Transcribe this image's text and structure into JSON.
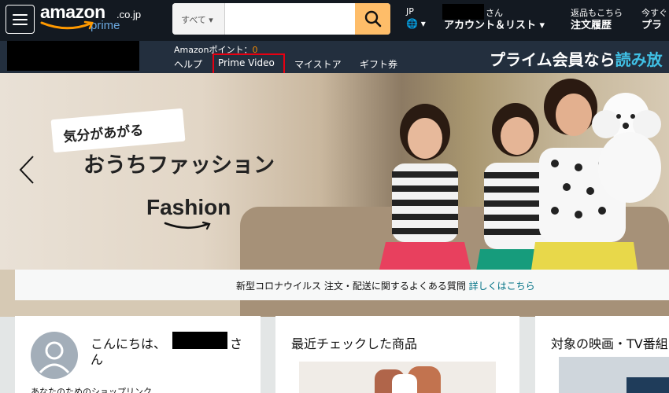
{
  "header": {
    "logo": {
      "word": "amazon",
      "tld": ".co.jp",
      "sub": "prime"
    },
    "search": {
      "category": "すべて ▾",
      "placeholder": ""
    },
    "language": {
      "code": "JP",
      "globe": "🌐 ▾"
    },
    "account": {
      "san": "さん",
      "label": "アカウント＆リスト ▾"
    },
    "orders": {
      "top": "返品もこちら",
      "label": "注文履歴"
    },
    "cart": {
      "top": "今すぐ",
      "label": "プラ"
    },
    "points": {
      "label": "Amazonポイント：",
      "value": "0"
    },
    "nav_links": [
      {
        "label": "ヘルプ"
      },
      {
        "label": "Prime Video"
      },
      {
        "label": "マイストア"
      },
      {
        "label": "ギフト券"
      }
    ],
    "promo": {
      "text": "プライム会員なら",
      "accent": "読み放"
    }
  },
  "hero": {
    "tagline": "気分があがる",
    "title": "おうちファッション",
    "brand": "Fashion"
  },
  "notice": {
    "text": "新型コロナウイルス 注文・配送に関するよくある質問 ",
    "link": "詳しくはこちら"
  },
  "cards": [
    {
      "greeting": "こんにちは、",
      "san": "さ",
      "san2": "ん",
      "sub": "あなたのためのショップリンク"
    },
    {
      "title": "最近チェックした商品"
    },
    {
      "title": "対象の映画・TV番組"
    }
  ],
  "colors": {
    "nav_dark": "#131921",
    "nav_mid": "#232f3e",
    "search_button": "#febd69",
    "highlight": "#e60012",
    "link": "#007185",
    "accent": "#40c1e6",
    "points": "#f08804"
  },
  "icons": {
    "menu": "hamburger-menu-icon",
    "search": "search-icon",
    "globe": "globe-icon",
    "prev": "chevron-left-icon",
    "avatar": "user-avatar-icon"
  }
}
